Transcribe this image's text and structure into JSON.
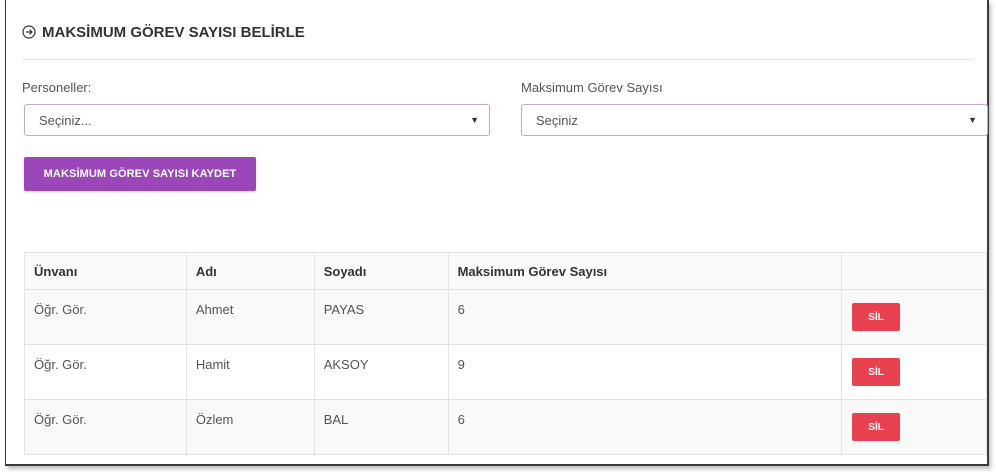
{
  "header": {
    "title": "MAKSİMUM GÖREV SAYISI BELİRLE",
    "icon": "arrow-circle-right-icon"
  },
  "form": {
    "personnel_label": "Personeller:",
    "personnel_value": "Seçiniz...",
    "max_label": "Maksimum Görev Sayısı",
    "max_value": "Seçiniz",
    "save_label": "MAKSİMUM GÖREV SAYISI KAYDET"
  },
  "table": {
    "headers": [
      "Ünvanı",
      "Adı",
      "Soyadı",
      "Maksimum Görev Sayısı",
      ""
    ],
    "rows": [
      {
        "title": "Öğr. Gör.",
        "name": "Ahmet",
        "surname": "PAYAS",
        "max": "6",
        "action": "SİL"
      },
      {
        "title": "Öğr. Gör.",
        "name": "Hamit",
        "surname": "AKSOY",
        "max": "9",
        "action": "SİL"
      },
      {
        "title": "Öğr. Gör.",
        "name": "Özlem",
        "surname": "BAL",
        "max": "6",
        "action": "SİL"
      }
    ]
  },
  "colors": {
    "primary_purple": "#9b46b9",
    "danger_red": "#e8414f"
  }
}
